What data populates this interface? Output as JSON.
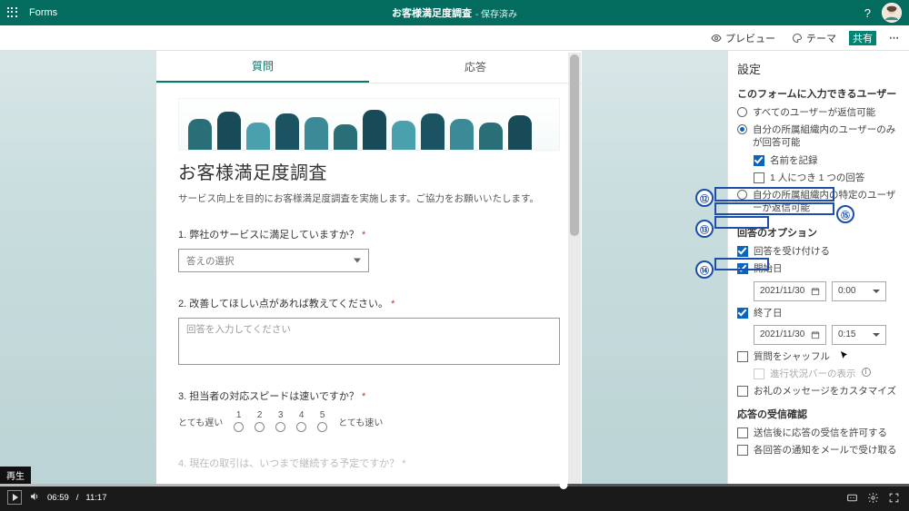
{
  "header": {
    "brand": "Forms",
    "doc_title": "お客様満足度調査",
    "save_state": "- 保存済み"
  },
  "actionbar": {
    "preview": "プレビュー",
    "theme": "テーマ",
    "share": "共有"
  },
  "tabs": {
    "questions": "質問",
    "responses": "応答"
  },
  "form": {
    "title": "お客様満足度調査",
    "desc": "サービス向上を目的にお客様満足度調査を実施します。ご協力をお願いいたします。",
    "q1": {
      "label": "1. 弊社のサービスに満足していますか？",
      "req": "*",
      "select_placeholder": "答えの選択"
    },
    "q2": {
      "label": "2. 改善してほしい点があれば教えてください。",
      "req": "*",
      "placeholder": "回答を入力してください"
    },
    "q3": {
      "label": "3. 担当者の対応スピードは速いですか？",
      "req": "*",
      "low": "とても遅い",
      "high": "とても速い",
      "n1": "1",
      "n2": "2",
      "n3": "3",
      "n4": "4",
      "n5": "5"
    },
    "q4": {
      "label": "4. 現在の取引は、いつまで継続する予定ですか？ *"
    }
  },
  "settings": {
    "title": "設定",
    "who": {
      "heading": "このフォームに入力できるユーザー",
      "opt_anyone": "すべてのユーザーが返信可能",
      "opt_org": "自分の所属組織内のユーザーのみが回答可能",
      "opt_record_name": "名前を記録",
      "opt_one_per": "1 人につき 1 つの回答",
      "opt_specific": "自分の所属組織内の特定のユーザーが返信可能"
    },
    "resp": {
      "heading": "回答のオプション",
      "accept": "回答を受け付ける",
      "start": "開始日",
      "end": "終了日",
      "date1": "2021/11/30",
      "time1": "0:00",
      "date2": "2021/11/30",
      "time2": "0:15",
      "shuffle": "質問をシャッフル",
      "progress": "進行状況バーの表示",
      "thankyou": "お礼のメッセージをカスタマイズ"
    },
    "receipt": {
      "heading": "応答の受信確認",
      "allow": "送信後に応答の受信を許可する",
      "email": "各回答の通知をメールで受け取る"
    }
  },
  "annotations": {
    "n12": "⑫",
    "n13": "⑬",
    "n14": "⑭",
    "n15": "⑮"
  },
  "video": {
    "play_label": "再生",
    "elapsed": "06:59",
    "sep": "/",
    "total": "11:17"
  }
}
